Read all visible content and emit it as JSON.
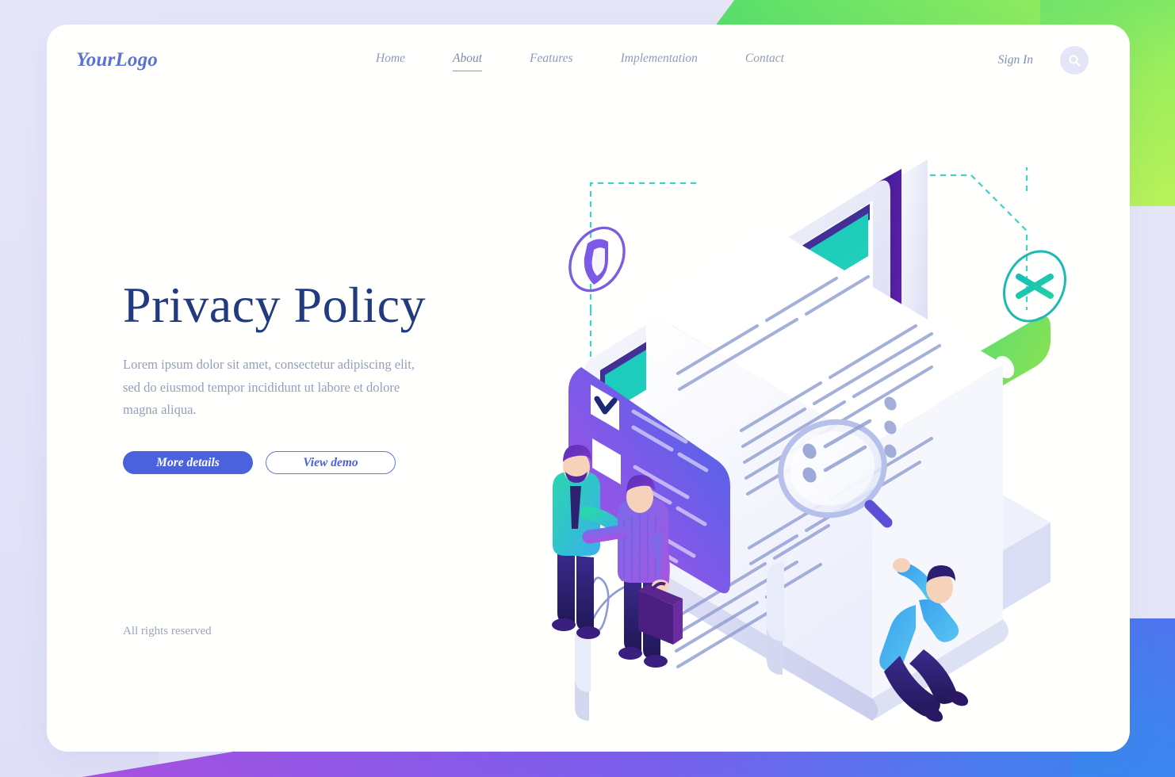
{
  "header": {
    "logo": "YourLogo",
    "nav": [
      {
        "label": "Home",
        "active": false
      },
      {
        "label": "About",
        "active": true
      },
      {
        "label": "Features",
        "active": false
      },
      {
        "label": "Implementation",
        "active": false
      },
      {
        "label": "Contact",
        "active": false
      }
    ],
    "signin_label": "Sign In",
    "search_icon": "search-icon"
  },
  "hero": {
    "title": "Privacy Policy",
    "subtitle": "Lorem ipsum dolor sit amet, consectetur adipiscing elit, sed do eiusmod tempor incididunt ut labore et dolore magna aliqua.",
    "primary_button": "More details",
    "secondary_button": "View demo"
  },
  "footer": {
    "rights": "All rights reserved"
  },
  "illustration": {
    "name": "privacy-policy-isometric-illustration",
    "elements": [
      "tablet-device",
      "padlock-icon",
      "password-field-dots",
      "asterisk-badge-icon",
      "shield-badge-icon",
      "consent-checkbox-card",
      "document-scroll",
      "signature-squiggle",
      "magnifying-glass-icon",
      "person-handshake-left",
      "person-handshake-right",
      "person-with-magnifier"
    ],
    "password_dot_count": 6,
    "checkbox_checked_count": 1,
    "checkbox_total": 2
  },
  "colors": {
    "brand_blue": "#4a62de",
    "logo_blue": "#5972d4",
    "heading_navy": "#213a80",
    "body_text": "#93a0ba",
    "nav_text": "#8e9bb8",
    "page_bg_lavender": "#e6e6f8",
    "deco_green": "#6ee36a",
    "deco_teal": "#00b8c4",
    "deco_purple": "#b44fe0",
    "deco_blue": "#3a82ef",
    "card_bg": "#ffffff",
    "lock_teal": "#19c6cb",
    "lock_blue": "#2f7eea",
    "password_green_a": "#3fd98c",
    "password_green_b": "#8ae04e",
    "checkbox_card_purple": "#a44ce0",
    "checkbox_card_blue": "#3f6ae8",
    "line_slate": "#8d9bd0"
  }
}
